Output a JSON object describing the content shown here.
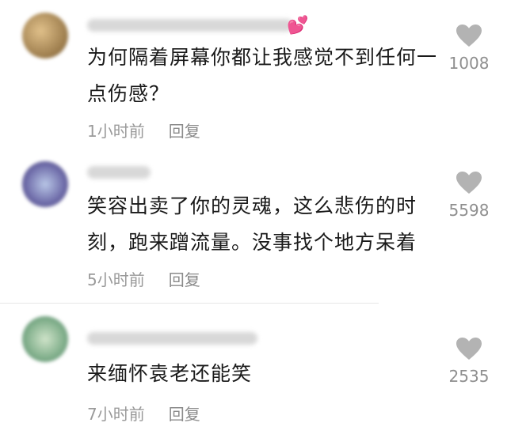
{
  "comments": [
    {
      "text": "为何隔着屏幕你都让我感觉不到任何一点伤感？",
      "time": "1小时前",
      "reply": "回复",
      "likes": "1008",
      "avatar_color": "#c9a46a"
    },
    {
      "text": "笑容出卖了你的灵魂，这么悲伤的时刻，跑来蹭流量。没事找个地方呆着",
      "time": "5小时前",
      "reply": "回复",
      "likes": "5598",
      "avatar_color": "#6a6aa8"
    },
    {
      "text": "来缅怀袁老还能笑",
      "time": "7小时前",
      "reply": "回复",
      "likes": "2535",
      "avatar_color": "#8fb59a"
    }
  ]
}
